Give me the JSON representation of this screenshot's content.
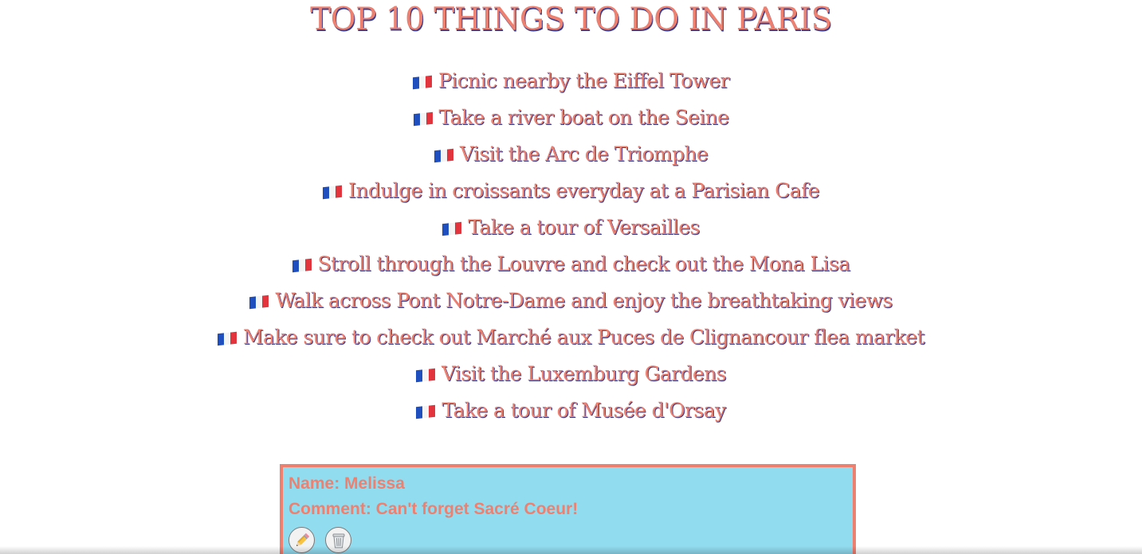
{
  "page": {
    "title": "TOP 10 THINGS TO DO IN PARIS"
  },
  "list": {
    "icon": "france-flag-icon",
    "items": [
      {
        "label": "Picnic nearby the Eiffel Tower"
      },
      {
        "label": "Take a river boat on the Seine"
      },
      {
        "label": "Visit the Arc de Triomphe"
      },
      {
        "label": "Indulge in croissants everyday at a Parisian Cafe"
      },
      {
        "label": "Take a tour of Versailles"
      },
      {
        "label": "Stroll through the Louvre and check out the Mona Lisa"
      },
      {
        "label": "Walk across Pont Notre-Dame and enjoy the breathtaking views"
      },
      {
        "label": "Make sure to check out Marché aux Puces de Clignancour flea market"
      },
      {
        "label": "Visit the Luxemburg Gardens"
      },
      {
        "label": "Take a tour of Musée d'Orsay"
      }
    ]
  },
  "comment": {
    "name_line": "Name: Melissa",
    "comment_line": "Comment: Can't forget Sacré Coeur!",
    "edit_icon": "pencil-icon",
    "delete_icon": "trash-icon"
  },
  "colors": {
    "accent": "#ee8070",
    "shadow": "#3b3f8f",
    "card_background": "#92dcf0",
    "flag_blue": "#1f4fbf",
    "flag_white": "#f4f4f4",
    "flag_red": "#e2343c"
  }
}
